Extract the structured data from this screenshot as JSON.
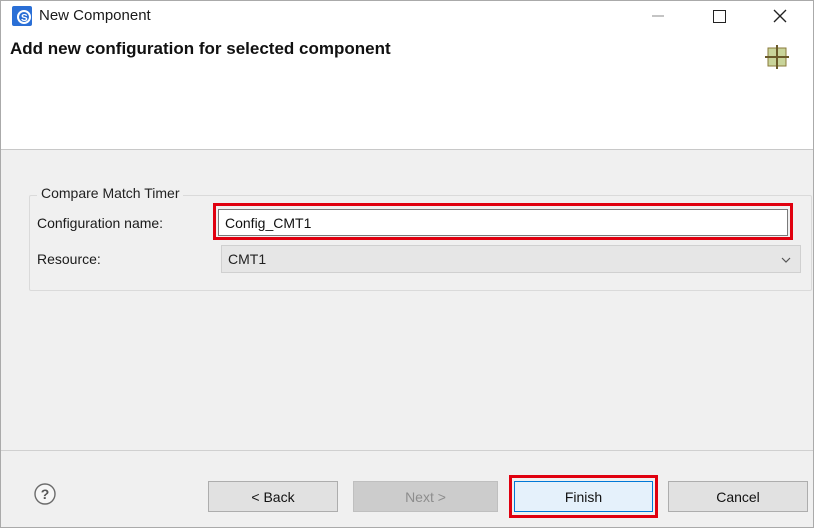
{
  "window": {
    "title": "New Component"
  },
  "header": {
    "title": "Add new configuration for selected component"
  },
  "group": {
    "label": "Compare Match Timer",
    "configuration_name_label": "Configuration name:",
    "configuration_name_value": "Config_CMT1",
    "resource_label": "Resource:",
    "resource_value": "CMT1"
  },
  "footer": {
    "back_label": "< Back",
    "next_label": "Next >",
    "finish_label": "Finish",
    "cancel_label": "Cancel"
  },
  "icons": {
    "app": "app-logo-icon",
    "header": "component-grid-icon",
    "help": "help-icon"
  },
  "colors": {
    "highlight": "#e0000f",
    "focus": "#0078d7",
    "app_icon": "#2a6fd6"
  }
}
